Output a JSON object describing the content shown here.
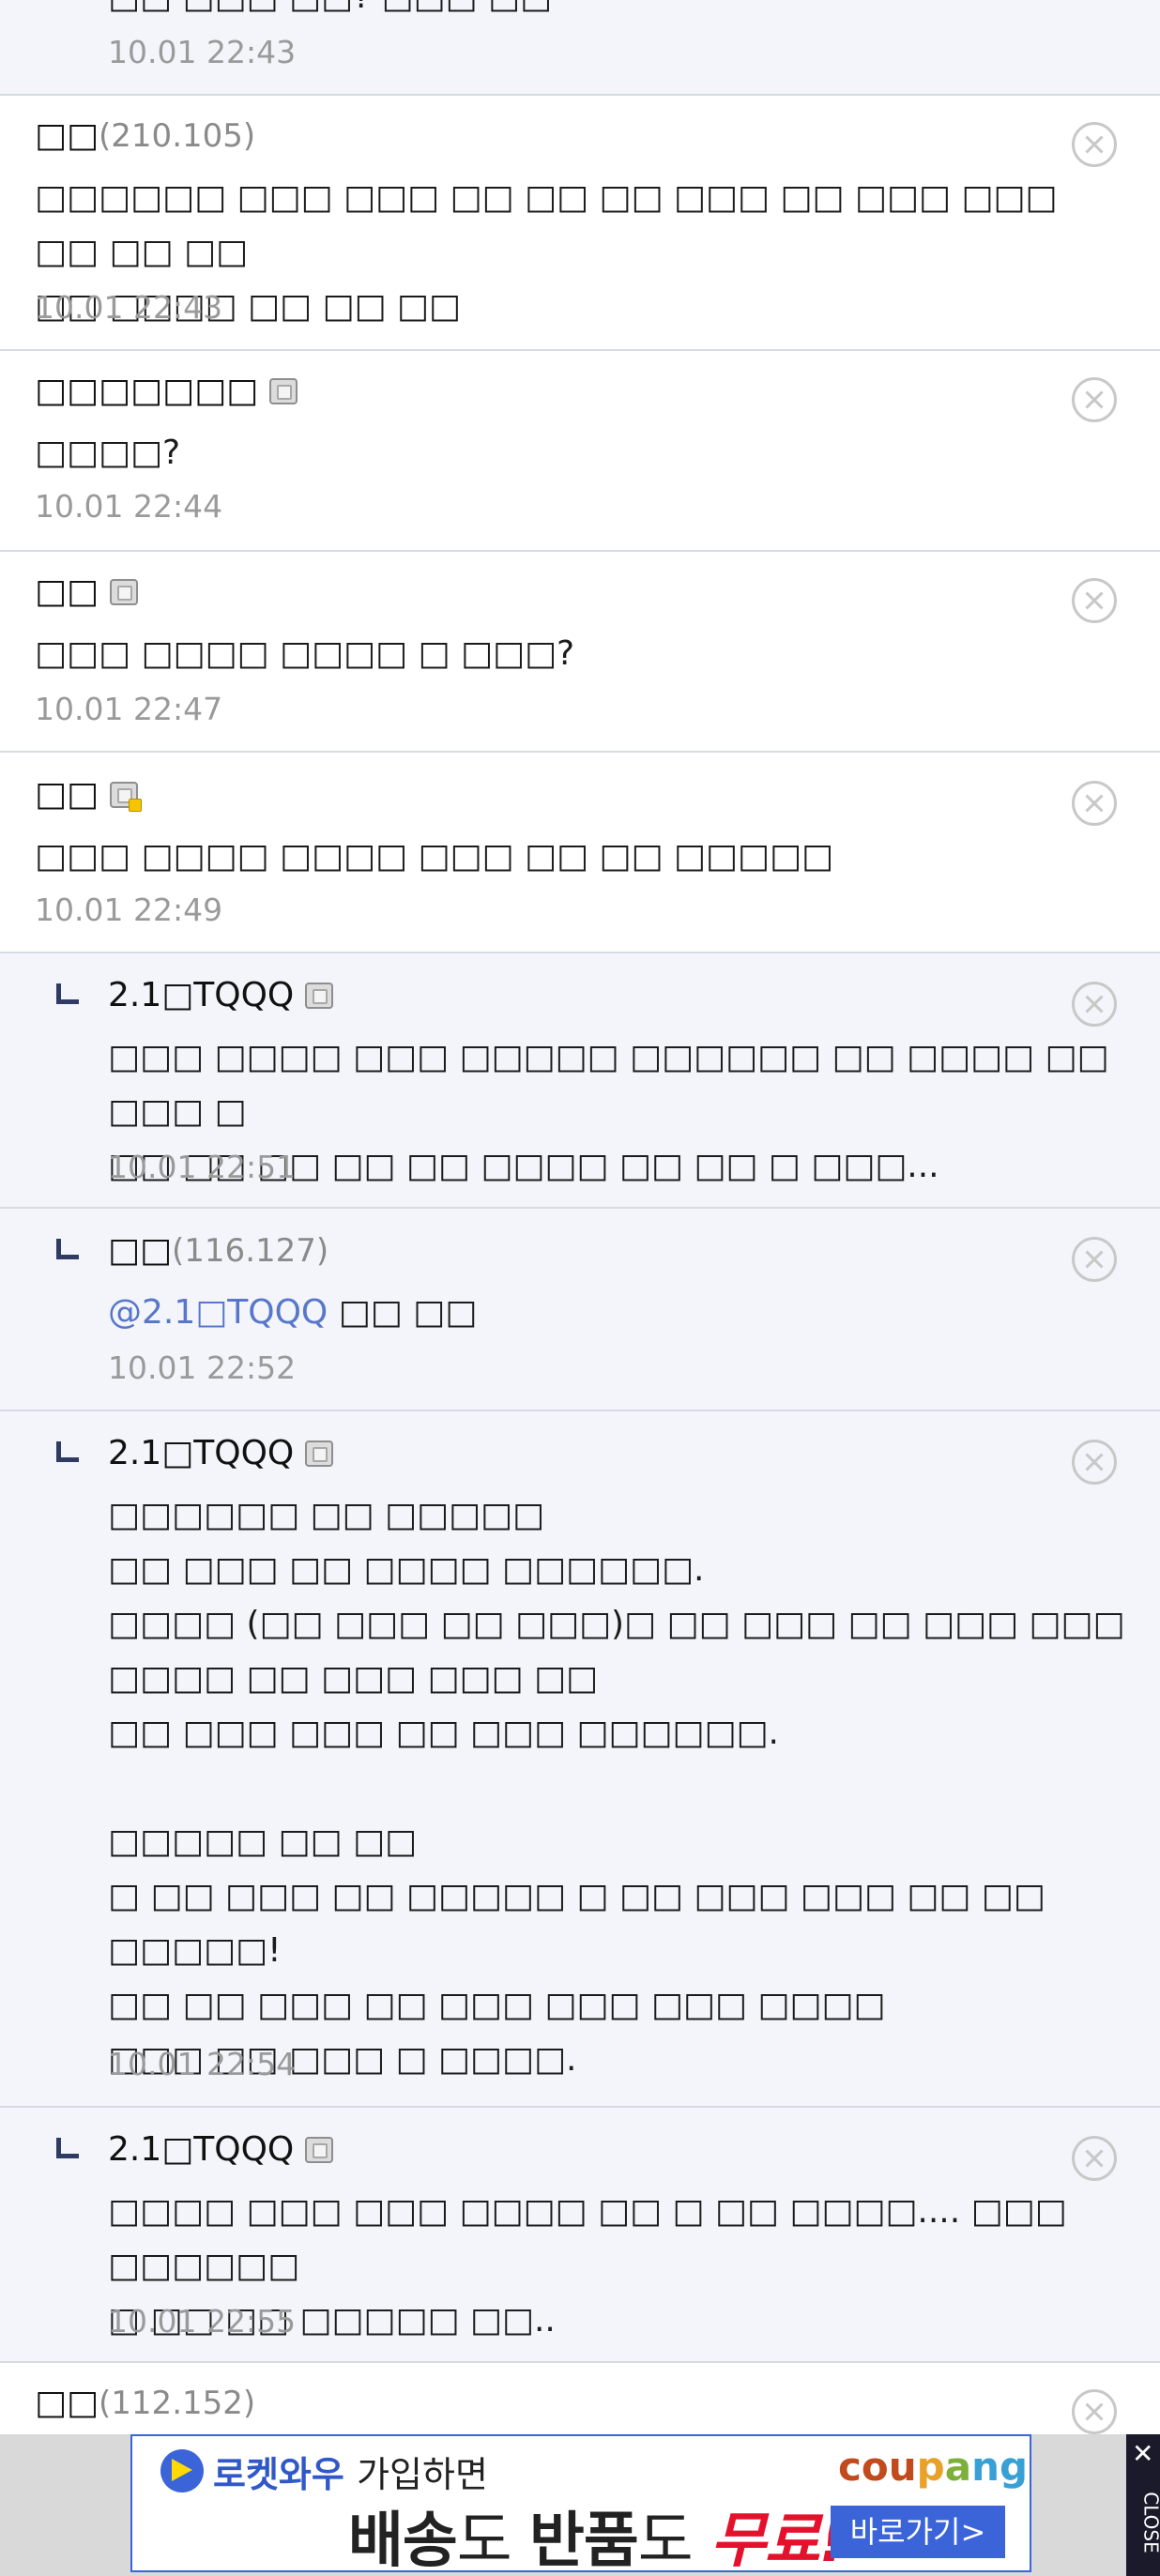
{
  "comments": [
    {
      "kind": "plain",
      "ip": "",
      "nick": "",
      "icon": "",
      "text": "□□ □□□ □□? □□□ □□",
      "date": "10.01 22:43"
    },
    {
      "kind": "plain",
      "nick": "□□",
      "ip": "(210.105)",
      "icon": "",
      "text": "□□□□□□ □□□ □□□ □□ □□ □□ □□□ □□ □□□ □□□ □□ □□ □□\n□□ □□□□ □□ □□ □□",
      "date": "10.01 22:43"
    },
    {
      "kind": "plain",
      "nick": "□□□□□□□",
      "ip": "",
      "icon": "member-icon",
      "text": "□□□□?",
      "date": "10.01 22:44"
    },
    {
      "kind": "plain",
      "nick": "□□",
      "ip": "",
      "icon": "member-icon",
      "text": "□□□ □□□□ □□□□ □ □□□?",
      "date": "10.01 22:47"
    },
    {
      "kind": "plain",
      "nick": "□□",
      "ip": "",
      "icon": "fixed-member-icon",
      "text": "□□□ □□□□ □□□□ □□□ □□ □□ □□□□□",
      "date": "10.01 22:49"
    },
    {
      "kind": "reply",
      "nick": "2.1□TQQQ",
      "ip": "",
      "icon": "member-icon",
      "text": "□□□ □□□□ □□□ □□□□□ □□□□□□ □□ □□□□ □□ □□□ □\n□□ □□ □□ □□ □□ □□□□ □□ □□ □ □□□...",
      "date": "10.01 22:51"
    },
    {
      "kind": "reply",
      "nick": "□□",
      "ip": "(116.127)",
      "icon": "",
      "mention": "@2.1□TQQQ",
      "text": " □□ □□",
      "date": "10.01 22:52"
    },
    {
      "kind": "reply",
      "nick": "2.1□TQQQ",
      "ip": "",
      "icon": "member-icon",
      "text": "□□□□□□ □□ □□□□□\n□□ □□□ □□ □□□□ □□□□□□.\n□□□□ (□□ □□□ □□ □□□)□ □□ □□□ □□ □□□ □□□\n□□□□ □□ □□□ □□□ □□\n□□ □□□ □□□ □□ □□□ □□□□□□.\n\n□□□□□ □□ □□\n□ □□ □□□ □□ □□□□□ □ □□ □□□ □□□ □□ □□ □□□□□!\n□□ □□ □□□ □□ □□□ □□□ □□□ □□□□\n□□□ □□ □□□ □ □□□□.",
      "date": "10.01 22:54"
    },
    {
      "kind": "reply",
      "nick": "2.1□TQQQ",
      "ip": "",
      "icon": "member-icon",
      "text": "□□□□ □□□ □□□ □□□□ □□ □ □□ □□□□.... □□□ □□□□□□\n□ □□ □□ □□□□□ □□..",
      "date": "10.01 22:55"
    },
    {
      "kind": "plain",
      "nick": "□□",
      "ip": "(112.152)",
      "icon": "",
      "text": "",
      "date": ""
    }
  ],
  "ad": {
    "rocket_brand": "로켓와우",
    "join_text": "가입하면",
    "brand_parts": [
      "cou",
      "p",
      "a",
      "ng"
    ],
    "headline_a": "배송",
    "headline_b": "도 ",
    "headline_c": "반품",
    "headline_d": "도 ",
    "headline_e": "무료!",
    "cta": "바로가기>",
    "close_x": "✕",
    "close_label": "CLOSE"
  },
  "colors": {
    "reply_bg": "#f3f5fa",
    "divider": "#d6dbe3",
    "date": "#9a9a9a",
    "mention": "#5877c9",
    "ad_blue": "#3a64d8",
    "ad_red": "#e4112c"
  }
}
